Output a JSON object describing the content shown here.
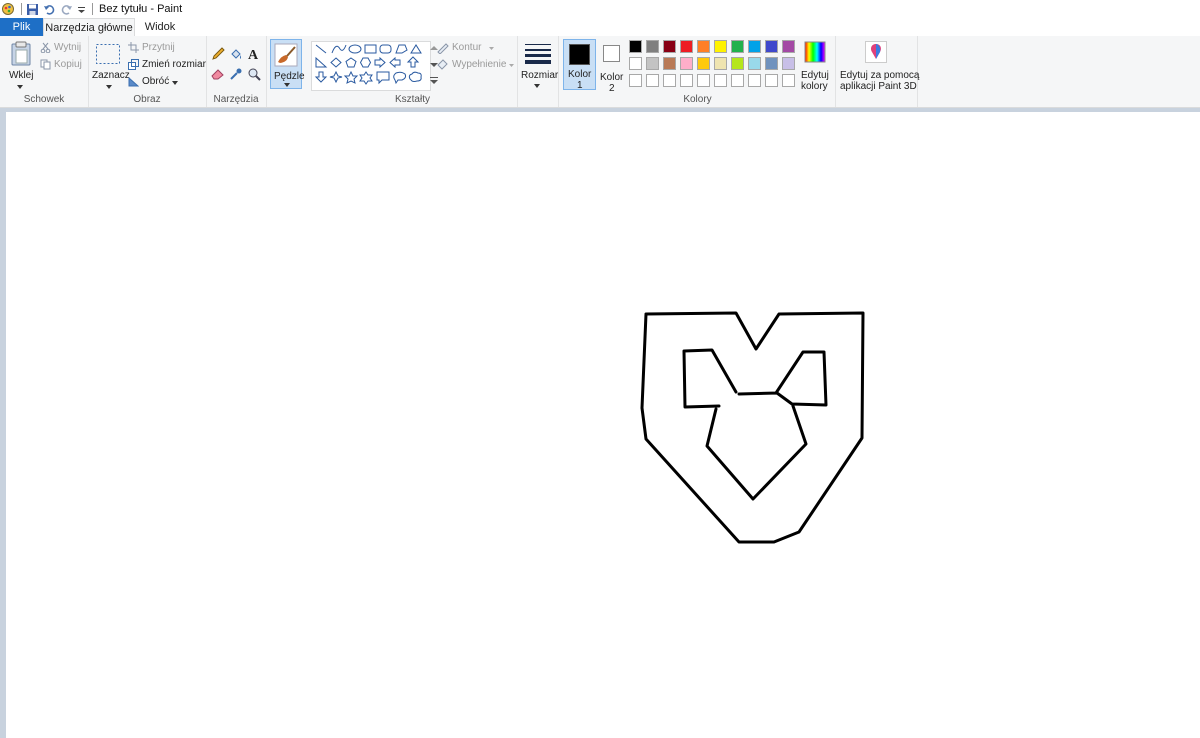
{
  "window": {
    "title": "Bez tytułu - Paint"
  },
  "tabs": [
    {
      "label": "Plik"
    },
    {
      "label": "Narzędzia główne"
    },
    {
      "label": "Widok"
    }
  ],
  "ribbon": {
    "clipboard": {
      "group": "Schowek",
      "paste": "Wklej",
      "cut": "Wytnij",
      "copy": "Kopiuj"
    },
    "image": {
      "group": "Obraz",
      "select": "Zaznacz",
      "crop": "Przytnij",
      "resize": "Zmień rozmiar",
      "rotate": "Obróć"
    },
    "tools": {
      "group": "Narzędzia"
    },
    "brushes": {
      "label": "Pędzle"
    },
    "shapes": {
      "group": "Kształty",
      "outline": "Kontur",
      "fill": "Wypełnienie"
    },
    "size": {
      "label": "Rozmiar"
    },
    "colors": {
      "group": "Kolory",
      "color1_label": "Kolor",
      "color1_num": "1",
      "color2_label": "Kolor",
      "color2_num": "2",
      "edit_label1": "Edytuj",
      "edit_label2": "kolory",
      "color1": "#000000",
      "color2": "#ffffff",
      "palette_row1": [
        "#000000",
        "#7f7f7f",
        "#880015",
        "#ed1c24",
        "#ff7f27",
        "#fff200",
        "#22b14c",
        "#00a2e8",
        "#3f48cc",
        "#a349a4"
      ],
      "palette_row2": [
        "#ffffff",
        "#c3c3c3",
        "#b97a57",
        "#ffaec9",
        "#ffc90e",
        "#efe4b0",
        "#b5e61d",
        "#99d9ea",
        "#7092be",
        "#c8bfe7"
      ],
      "palette_row3": [
        "#ffffff",
        "#ffffff",
        "#ffffff",
        "#ffffff",
        "#ffffff",
        "#ffffff",
        "#ffffff",
        "#ffffff",
        "#ffffff",
        "#ffffff"
      ]
    },
    "paint3d": {
      "line1": "Edytuj za pomocą",
      "line2": "aplikacji Paint 3D"
    }
  }
}
